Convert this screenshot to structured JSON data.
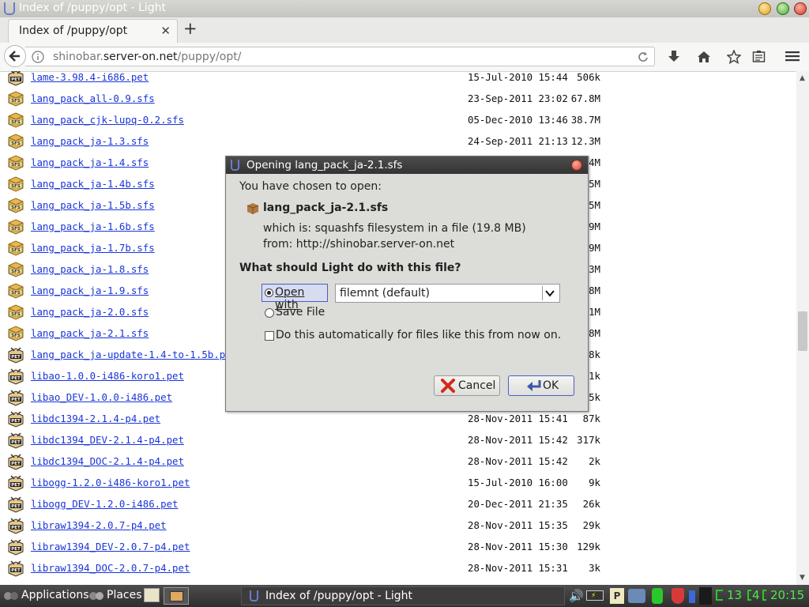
{
  "window": {
    "title": "Index of /puppy/opt - Light"
  },
  "tab": {
    "label": "Index of /puppy/opt"
  },
  "address": {
    "domain_pre": "shinobar.",
    "domain": "server-on.net",
    "path": "/puppy/opt/"
  },
  "files": [
    {
      "name": "lame-3.98.4-i686.pet",
      "date": "15-Jul-2010 15:44",
      "size": "506k",
      "icon": "pet-package-icon"
    },
    {
      "name": "lang_pack_all-0.9.sfs",
      "date": "23-Sep-2011 23:02",
      "size": "67.8M",
      "icon": "sfs-package-icon"
    },
    {
      "name": "lang_pack_cjk-lupq-0.2.sfs",
      "date": "05-Dec-2010 13:46",
      "size": "38.7M",
      "icon": "sfs-package-icon"
    },
    {
      "name": "lang_pack_ja-1.3.sfs",
      "date": "24-Sep-2011 21:13",
      "size": "12.3M",
      "icon": "sfs-package-icon"
    },
    {
      "name": "lang_pack_ja-1.4.sfs",
      "date": "",
      "size": "4M",
      "icon": "sfs-package-icon"
    },
    {
      "name": "lang_pack_ja-1.4b.sfs",
      "date": "",
      "size": "5M",
      "icon": "sfs-package-icon"
    },
    {
      "name": "lang_pack_ja-1.5b.sfs",
      "date": "",
      "size": "5M",
      "icon": "sfs-package-icon"
    },
    {
      "name": "lang_pack_ja-1.6b.sfs",
      "date": "",
      "size": "9M",
      "icon": "sfs-package-icon"
    },
    {
      "name": "lang_pack_ja-1.7b.sfs",
      "date": "",
      "size": "9M",
      "icon": "sfs-package-icon"
    },
    {
      "name": "lang_pack_ja-1.8.sfs",
      "date": "",
      "size": "3M",
      "icon": "sfs-package-icon"
    },
    {
      "name": "lang_pack_ja-1.9.sfs",
      "date": "",
      "size": "8M",
      "icon": "sfs-package-icon"
    },
    {
      "name": "lang_pack_ja-2.0.sfs",
      "date": "",
      "size": "1M",
      "icon": "sfs-package-icon"
    },
    {
      "name": "lang_pack_ja-2.1.sfs",
      "date": "",
      "size": "8M",
      "icon": "sfs-package-icon"
    },
    {
      "name": "lang_pack_ja-update-1.4-to-1.5b.pet",
      "date": "",
      "size": "8k",
      "icon": "pet-package-icon"
    },
    {
      "name": "libao-1.0.0-i486-koro1.pet",
      "date": "",
      "size": "1k",
      "icon": "pet-package-icon"
    },
    {
      "name": "libao_DEV-1.0.0-i486.pet",
      "date": "",
      "size": "5k",
      "icon": "pet-package-icon"
    },
    {
      "name": "libdc1394-2.1.4-p4.pet",
      "date": "28-Nov-2011 15:41",
      "size": "87k",
      "icon": "pet-package-icon"
    },
    {
      "name": "libdc1394_DEV-2.1.4-p4.pet",
      "date": "28-Nov-2011 15:42",
      "size": "317k",
      "icon": "pet-package-icon"
    },
    {
      "name": "libdc1394_DOC-2.1.4-p4.pet",
      "date": "28-Nov-2011 15:42",
      "size": "2k",
      "icon": "pet-package-icon"
    },
    {
      "name": "libogg-1.2.0-i486-koro1.pet",
      "date": "15-Jul-2010 16:00",
      "size": "9k",
      "icon": "pet-package-icon"
    },
    {
      "name": "libogg_DEV-1.2.0-i486.pet",
      "date": "20-Dec-2011 21:35",
      "size": "26k",
      "icon": "pet-package-icon"
    },
    {
      "name": "libraw1394-2.0.7-p4.pet",
      "date": "28-Nov-2011 15:35",
      "size": "29k",
      "icon": "pet-package-icon"
    },
    {
      "name": "libraw1394_DEV-2.0.7-p4.pet",
      "date": "28-Nov-2011 15:30",
      "size": "129k",
      "icon": "pet-package-icon"
    },
    {
      "name": "libraw1394_DOC-2.0.7-p4.pet",
      "date": "28-Nov-2011 15:31",
      "size": "3k",
      "icon": "pet-package-icon"
    }
  ],
  "dialog": {
    "title": "Opening lang_pack_ja-2.1.sfs",
    "chosen_text": "You have chosen to open:",
    "filename": "lang_pack_ja-2.1.sfs",
    "which_is": "which is: squashfs filesystem in a file (19.8 MB)",
    "from": "from: http://shinobar.server-on.net",
    "question": "What should Light do with this file?",
    "open_with_label": "Open with",
    "open_with_app": "filemnt (default)",
    "save_file_label": "Save File",
    "auto_label": "Do this automatically for files like this from now on.",
    "cancel_label": "Cancel",
    "ok_label": "OK",
    "selected_option": "open_with",
    "auto_checked": false
  },
  "taskbar": {
    "applications_label": "Applications",
    "places_label": "Places",
    "window_button_label": "Index of /puppy/opt - Light",
    "clock_a": "13",
    "clock_b": "4",
    "clock_time": "20:15"
  }
}
